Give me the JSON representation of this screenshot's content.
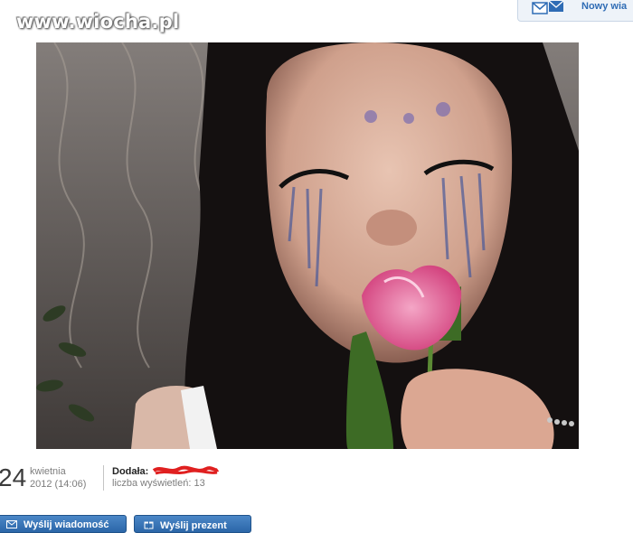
{
  "watermark": {
    "text": "www.wiocha.pl"
  },
  "header": {
    "new_message_label": "Nowy wia"
  },
  "photo": {
    "alt": ""
  },
  "post_meta": {
    "day": "24",
    "month": "kwietnia",
    "year_time": "2012 (14:06)",
    "added_by_label": "Dodała:",
    "views_label": "liczba wyświetleń:",
    "views_count": "13"
  },
  "actions": {
    "send_message": "Wyślij wiadomość",
    "send_gift": "Wyślij prezent"
  },
  "colors": {
    "button_blue": "#2b66a8",
    "link_blue": "#2f6cb5",
    "redaction_red": "#e02020"
  }
}
